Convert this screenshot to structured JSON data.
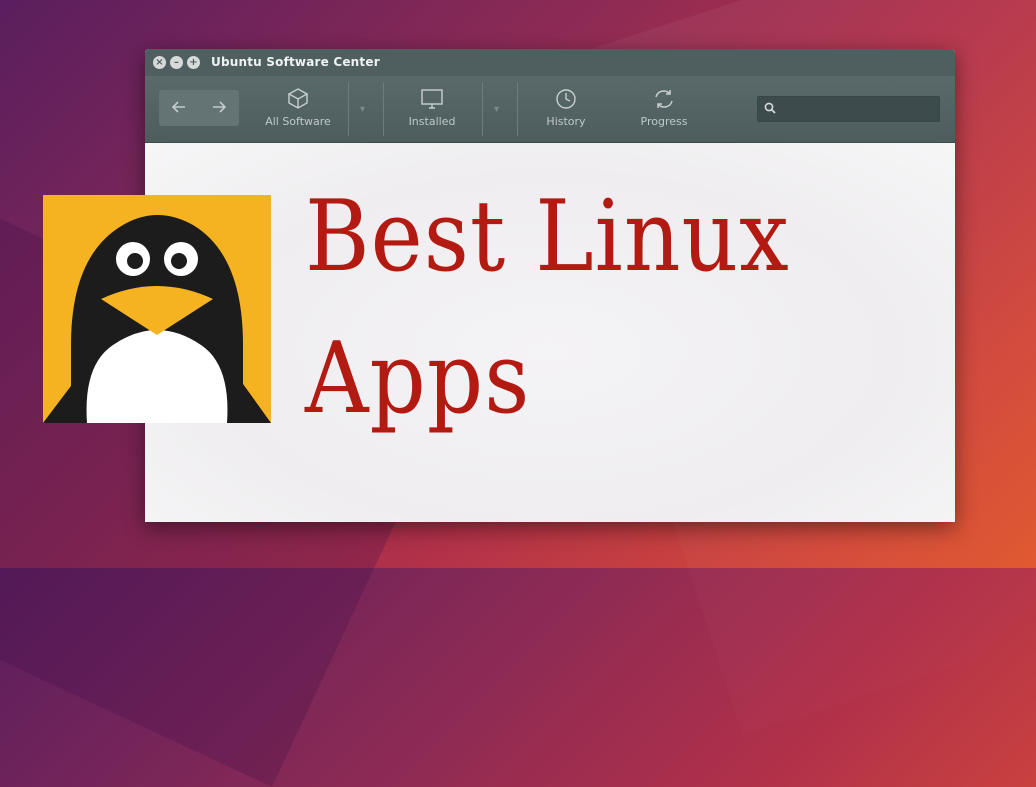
{
  "window": {
    "title": "Ubuntu Software Center"
  },
  "toolbar": {
    "back_icon": "arrow-left-icon",
    "forward_icon": "arrow-right-icon",
    "items": [
      {
        "label": "All Software",
        "icon": "box-icon"
      },
      {
        "label": "Installed",
        "icon": "monitor-icon"
      },
      {
        "label": "History",
        "icon": "clock-icon"
      },
      {
        "label": "Progress",
        "icon": "refresh-icon"
      }
    ],
    "search": {
      "value": "",
      "placeholder": "",
      "icon": "search-icon"
    }
  },
  "banner": {
    "line1": "Best Linux",
    "line2": "Apps"
  },
  "logo": {
    "icon": "tux-penguin-icon"
  },
  "colors": {
    "headline": "#b21a12",
    "titlebar": "#4f5f60",
    "logo_bg": "#f5b321"
  }
}
